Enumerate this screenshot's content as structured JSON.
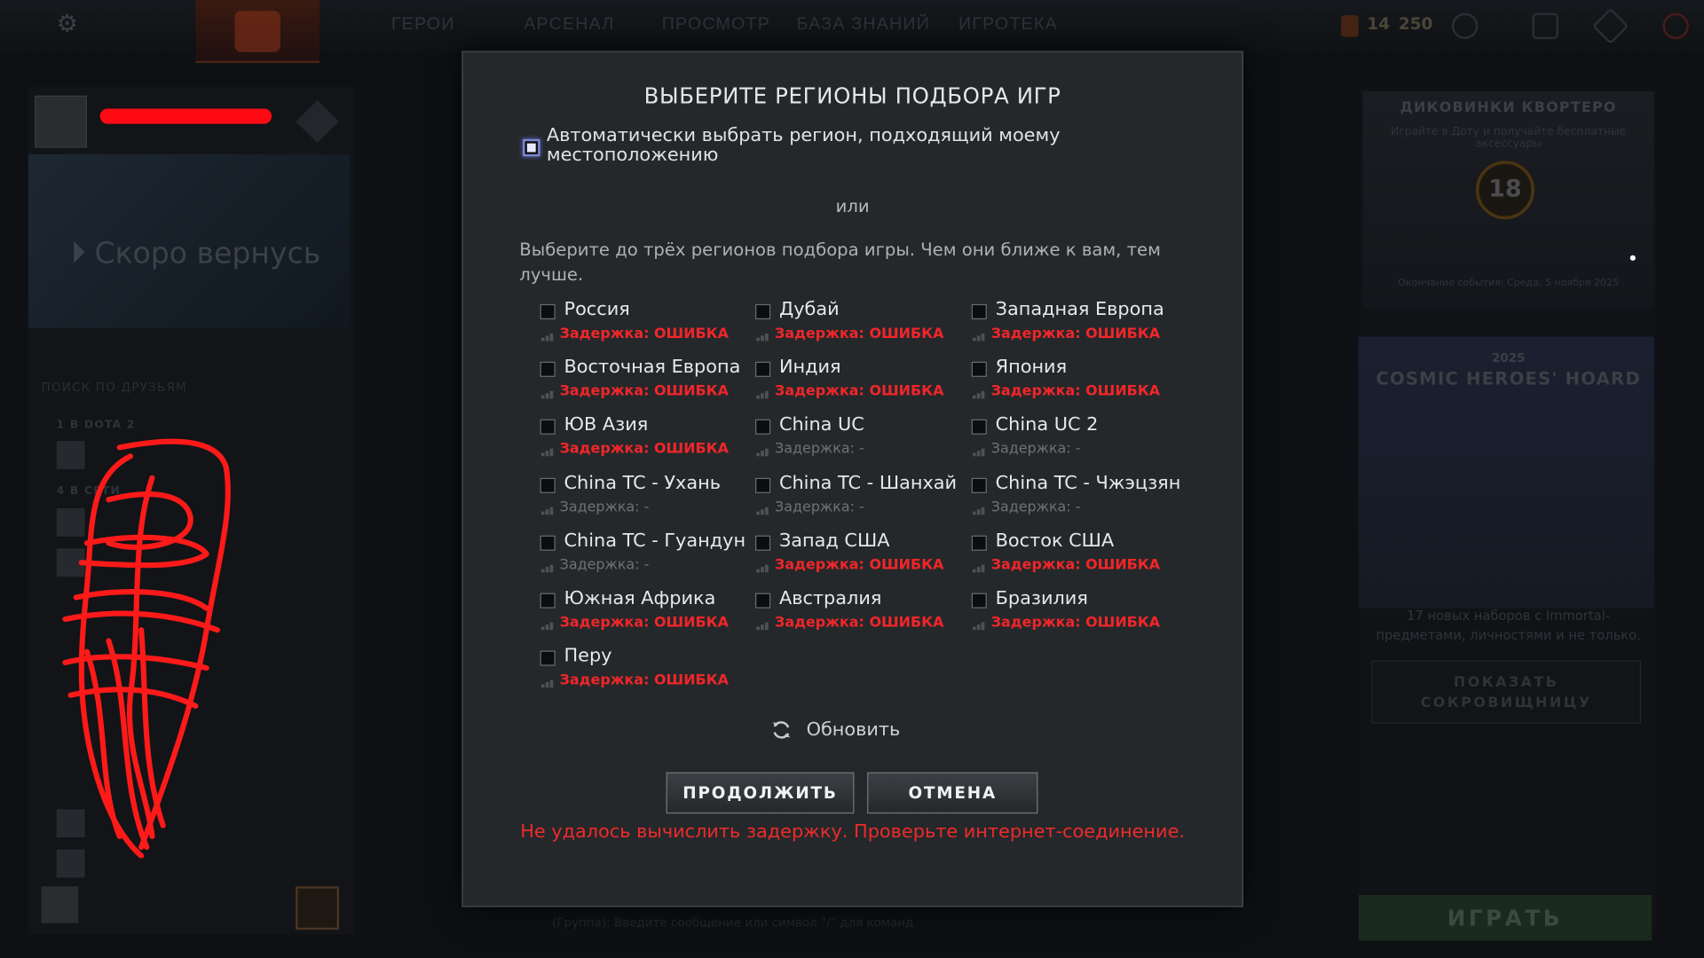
{
  "client": {
    "nav": [
      "ГЕРОИ",
      "АРСЕНАЛ",
      "ПРОСМОТР",
      "БАЗА ЗНАНИЙ",
      "ИГРОТЕКА"
    ],
    "currency_a": "14",
    "currency_b": "250",
    "status": "Скоро вернусь",
    "friends_search": "ПОИСК ПО ДРУЗЬЯМ",
    "group_dota": "1 В DOTA 2",
    "group_online": "4 В СЕТИ",
    "chat_placeholder": "(Группа): Введите сообщение или символ \"/\" для команд",
    "event_title": "ДИКОВИНКИ КВОРТЕРО",
    "event_subtitle": "Играйте в Доту и получайте бесплатные аксессуары",
    "event_level": "18",
    "event_ends": "Окончание события: Среда, 5 ноября 2025",
    "hoard_year": "2025",
    "hoard_title": "COSMIC HEROES' HOARD",
    "hoard_desc": "17 новых наборов с Immortal-предметами, личностями и не только.",
    "hoard_button": "ПОКАЗАТЬ СОКРОВИЩНИЦУ",
    "play_button": "ИГРАТЬ"
  },
  "modal": {
    "title": "ВЫБЕРИТЕ РЕГИОНЫ ПОДБОРА ИГР",
    "auto_label": "Автоматически выбрать регион, подходящий моему местоположению",
    "auto_checked": true,
    "or": "или",
    "instructions": "Выберите до трёх регионов подбора игры. Чем они ближе к вам, тем лучше.",
    "regions": [
      {
        "name": "Россия",
        "latency": "Задержка: ОШИБКА",
        "error": true
      },
      {
        "name": "Дубай",
        "latency": "Задержка: ОШИБКА",
        "error": true
      },
      {
        "name": "Западная Европа",
        "latency": "Задержка: ОШИБКА",
        "error": true
      },
      {
        "name": "Восточная Европа",
        "latency": "Задержка: ОШИБКА",
        "error": true
      },
      {
        "name": "Индия",
        "latency": "Задержка: ОШИБКА",
        "error": true
      },
      {
        "name": "Япония",
        "latency": "Задержка: ОШИБКА",
        "error": true
      },
      {
        "name": "ЮВ Азия",
        "latency": "Задержка: ОШИБКА",
        "error": true
      },
      {
        "name": "China UC",
        "latency": "Задержка: -",
        "error": false
      },
      {
        "name": "China UC 2",
        "latency": "Задержка: -",
        "error": false
      },
      {
        "name": "China TC - Ухань",
        "latency": "Задержка: -",
        "error": false
      },
      {
        "name": "China TC - Шанхай",
        "latency": "Задержка: -",
        "error": false
      },
      {
        "name": "China TC - Чжэцзян",
        "latency": "Задержка: -",
        "error": false
      },
      {
        "name": "China TC - Гуандун",
        "latency": "Задержка: -",
        "error": false
      },
      {
        "name": "Запад США",
        "latency": "Задержка: ОШИБКА",
        "error": true
      },
      {
        "name": "Восток США",
        "latency": "Задержка: ОШИБКА",
        "error": true
      },
      {
        "name": "Южная Африка",
        "latency": "Задержка: ОШИБКА",
        "error": true
      },
      {
        "name": "Австралия",
        "latency": "Задержка: ОШИБКА",
        "error": true
      },
      {
        "name": "Бразилия",
        "latency": "Задержка: ОШИБКА",
        "error": true
      },
      {
        "name": "Перу",
        "latency": "Задержка: ОШИБКА",
        "error": true
      }
    ],
    "refresh": "Обновить",
    "continue": "ПРОДОЛЖИТЬ",
    "cancel": "ОТМЕНА",
    "error": "Не удалось вычислить задержку. Проверьте интернет-соединение."
  },
  "colors": {
    "error_red": "#f0262a",
    "checkbox_focus": "#7a86d6"
  }
}
